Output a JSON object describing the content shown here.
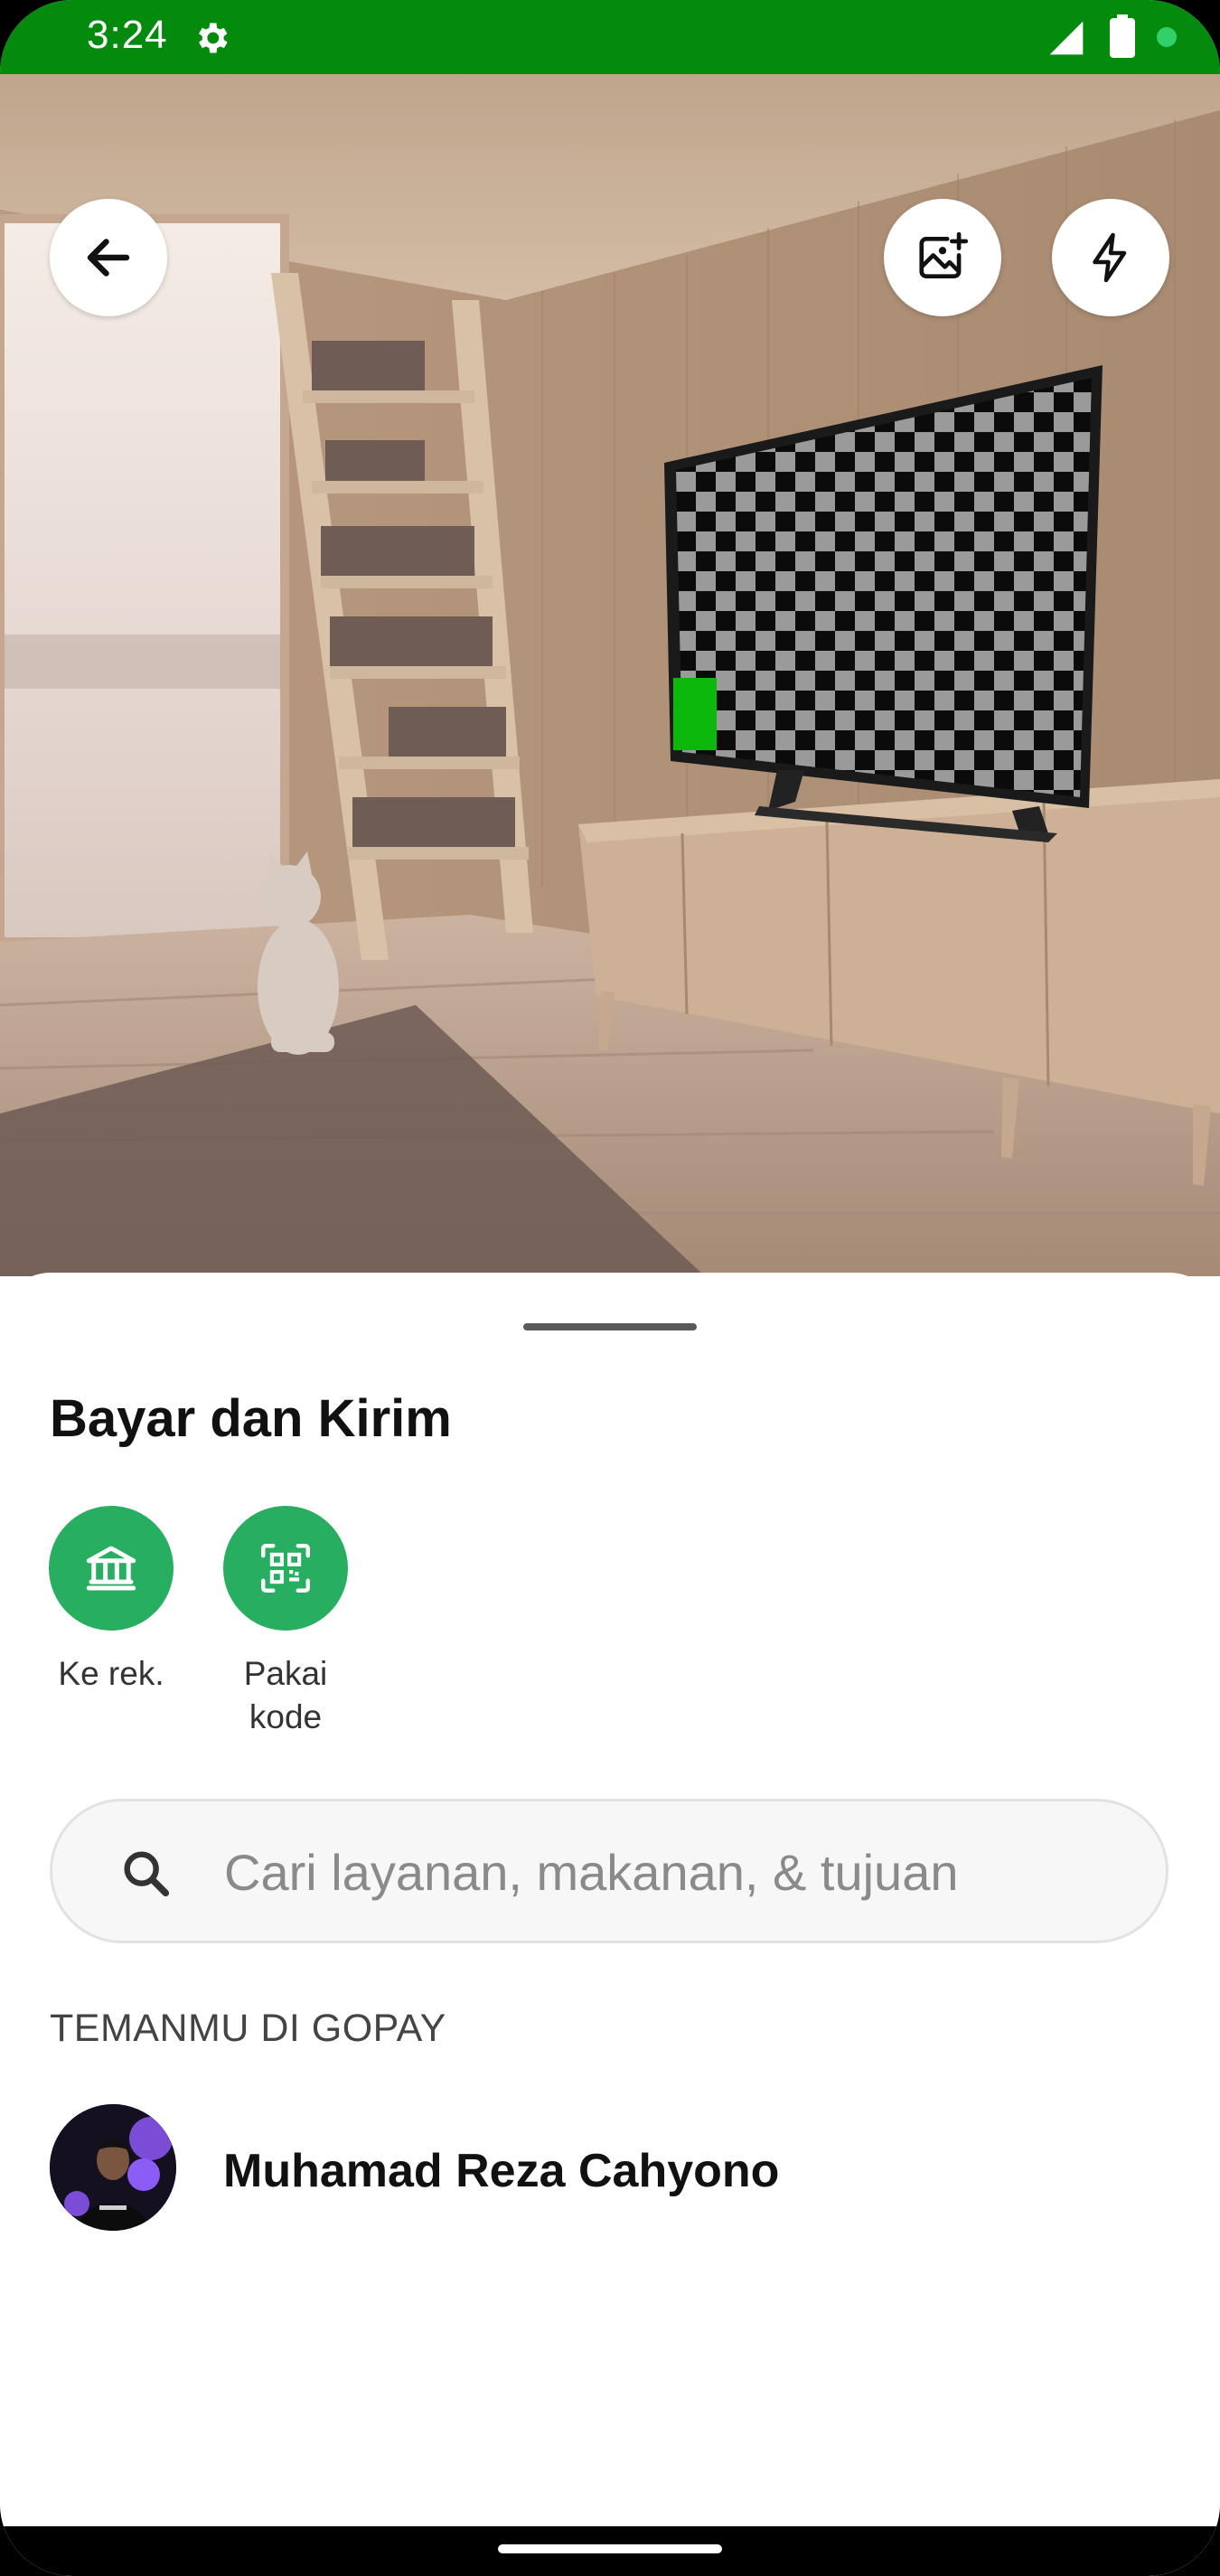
{
  "status_bar": {
    "time": "3:24",
    "gear_icon": "settings-gear-icon",
    "signal_icon": "cell-signal-icon",
    "battery_icon": "battery-icon",
    "background": "#048B0E"
  },
  "camera": {
    "back_icon": "arrow-left-icon",
    "gallery_icon": "image-add-icon",
    "flash_icon": "flash-icon"
  },
  "sheet": {
    "title": "Bayar dan Kirim",
    "actions": [
      {
        "label": "Ke rek.",
        "icon": "bank-icon"
      },
      {
        "label": "Pakai\nkode",
        "icon": "qr-code-icon"
      }
    ],
    "search": {
      "placeholder": "Cari layanan, makanan, & tujuan"
    },
    "section_label": "TEMANMU DI GOPAY",
    "contacts": [
      {
        "name": "Muhamad Reza Cahyono"
      }
    ],
    "accent": "#27AE60"
  }
}
